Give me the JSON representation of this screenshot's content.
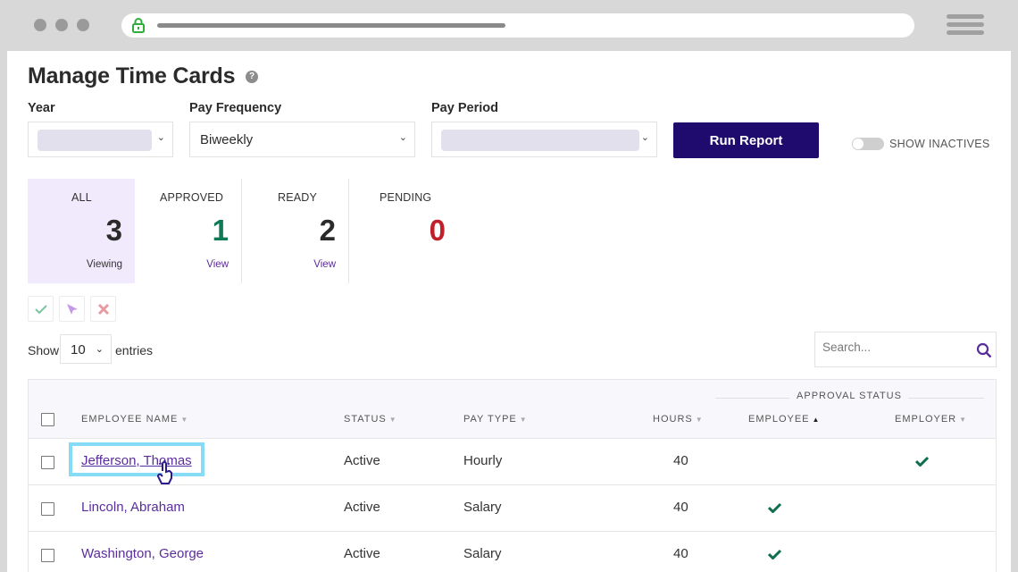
{
  "browser": {
    "lock_icon": "lock-icon",
    "menu_icon": "hamburger-icon"
  },
  "page": {
    "title": "Manage Time Cards",
    "help_icon": "?"
  },
  "filters": {
    "year": {
      "label": "Year",
      "value": ""
    },
    "pay_frequency": {
      "label": "Pay Frequency",
      "value": "Biweekly"
    },
    "pay_period": {
      "label": "Pay Period",
      "value": ""
    },
    "run_report_label": "Run Report",
    "show_inactives_label": "SHOW INACTIVES",
    "show_inactives_on": false
  },
  "summary": [
    {
      "label": "ALL",
      "count": "3",
      "link": "Viewing",
      "color": "#2b2b2b"
    },
    {
      "label": "APPROVED",
      "count": "1",
      "link": "View",
      "color": "#0f7a55"
    },
    {
      "label": "READY",
      "count": "2",
      "link": "View",
      "color": "#2b2b2b"
    },
    {
      "label": "PENDING",
      "count": "0",
      "link": "",
      "color": "#c0202b"
    }
  ],
  "bulk_actions": [
    {
      "name": "approve",
      "icon": "check-icon"
    },
    {
      "name": "send",
      "icon": "send-icon"
    },
    {
      "name": "reject",
      "icon": "x-icon"
    }
  ],
  "table_controls": {
    "show_label": "Show",
    "page_length": "10",
    "entries_label": "entries",
    "search_placeholder": "Search..."
  },
  "table": {
    "group_header": "APPROVAL STATUS",
    "columns": [
      "EMPLOYEE NAME",
      "STATUS",
      "PAY TYPE",
      "HOURS",
      "EMPLOYEE",
      "EMPLOYER"
    ],
    "rows": [
      {
        "name": "Jefferson, Thomas",
        "status": "Active",
        "pay_type": "Hourly",
        "hours": "40",
        "employee_approved": false,
        "employer_approved": true
      },
      {
        "name": "Lincoln, Abraham",
        "status": "Active",
        "pay_type": "Salary",
        "hours": "40",
        "employee_approved": true,
        "employer_approved": false
      },
      {
        "name": "Washington, George",
        "status": "Active",
        "pay_type": "Salary",
        "hours": "40",
        "employee_approved": true,
        "employer_approved": false
      }
    ]
  }
}
